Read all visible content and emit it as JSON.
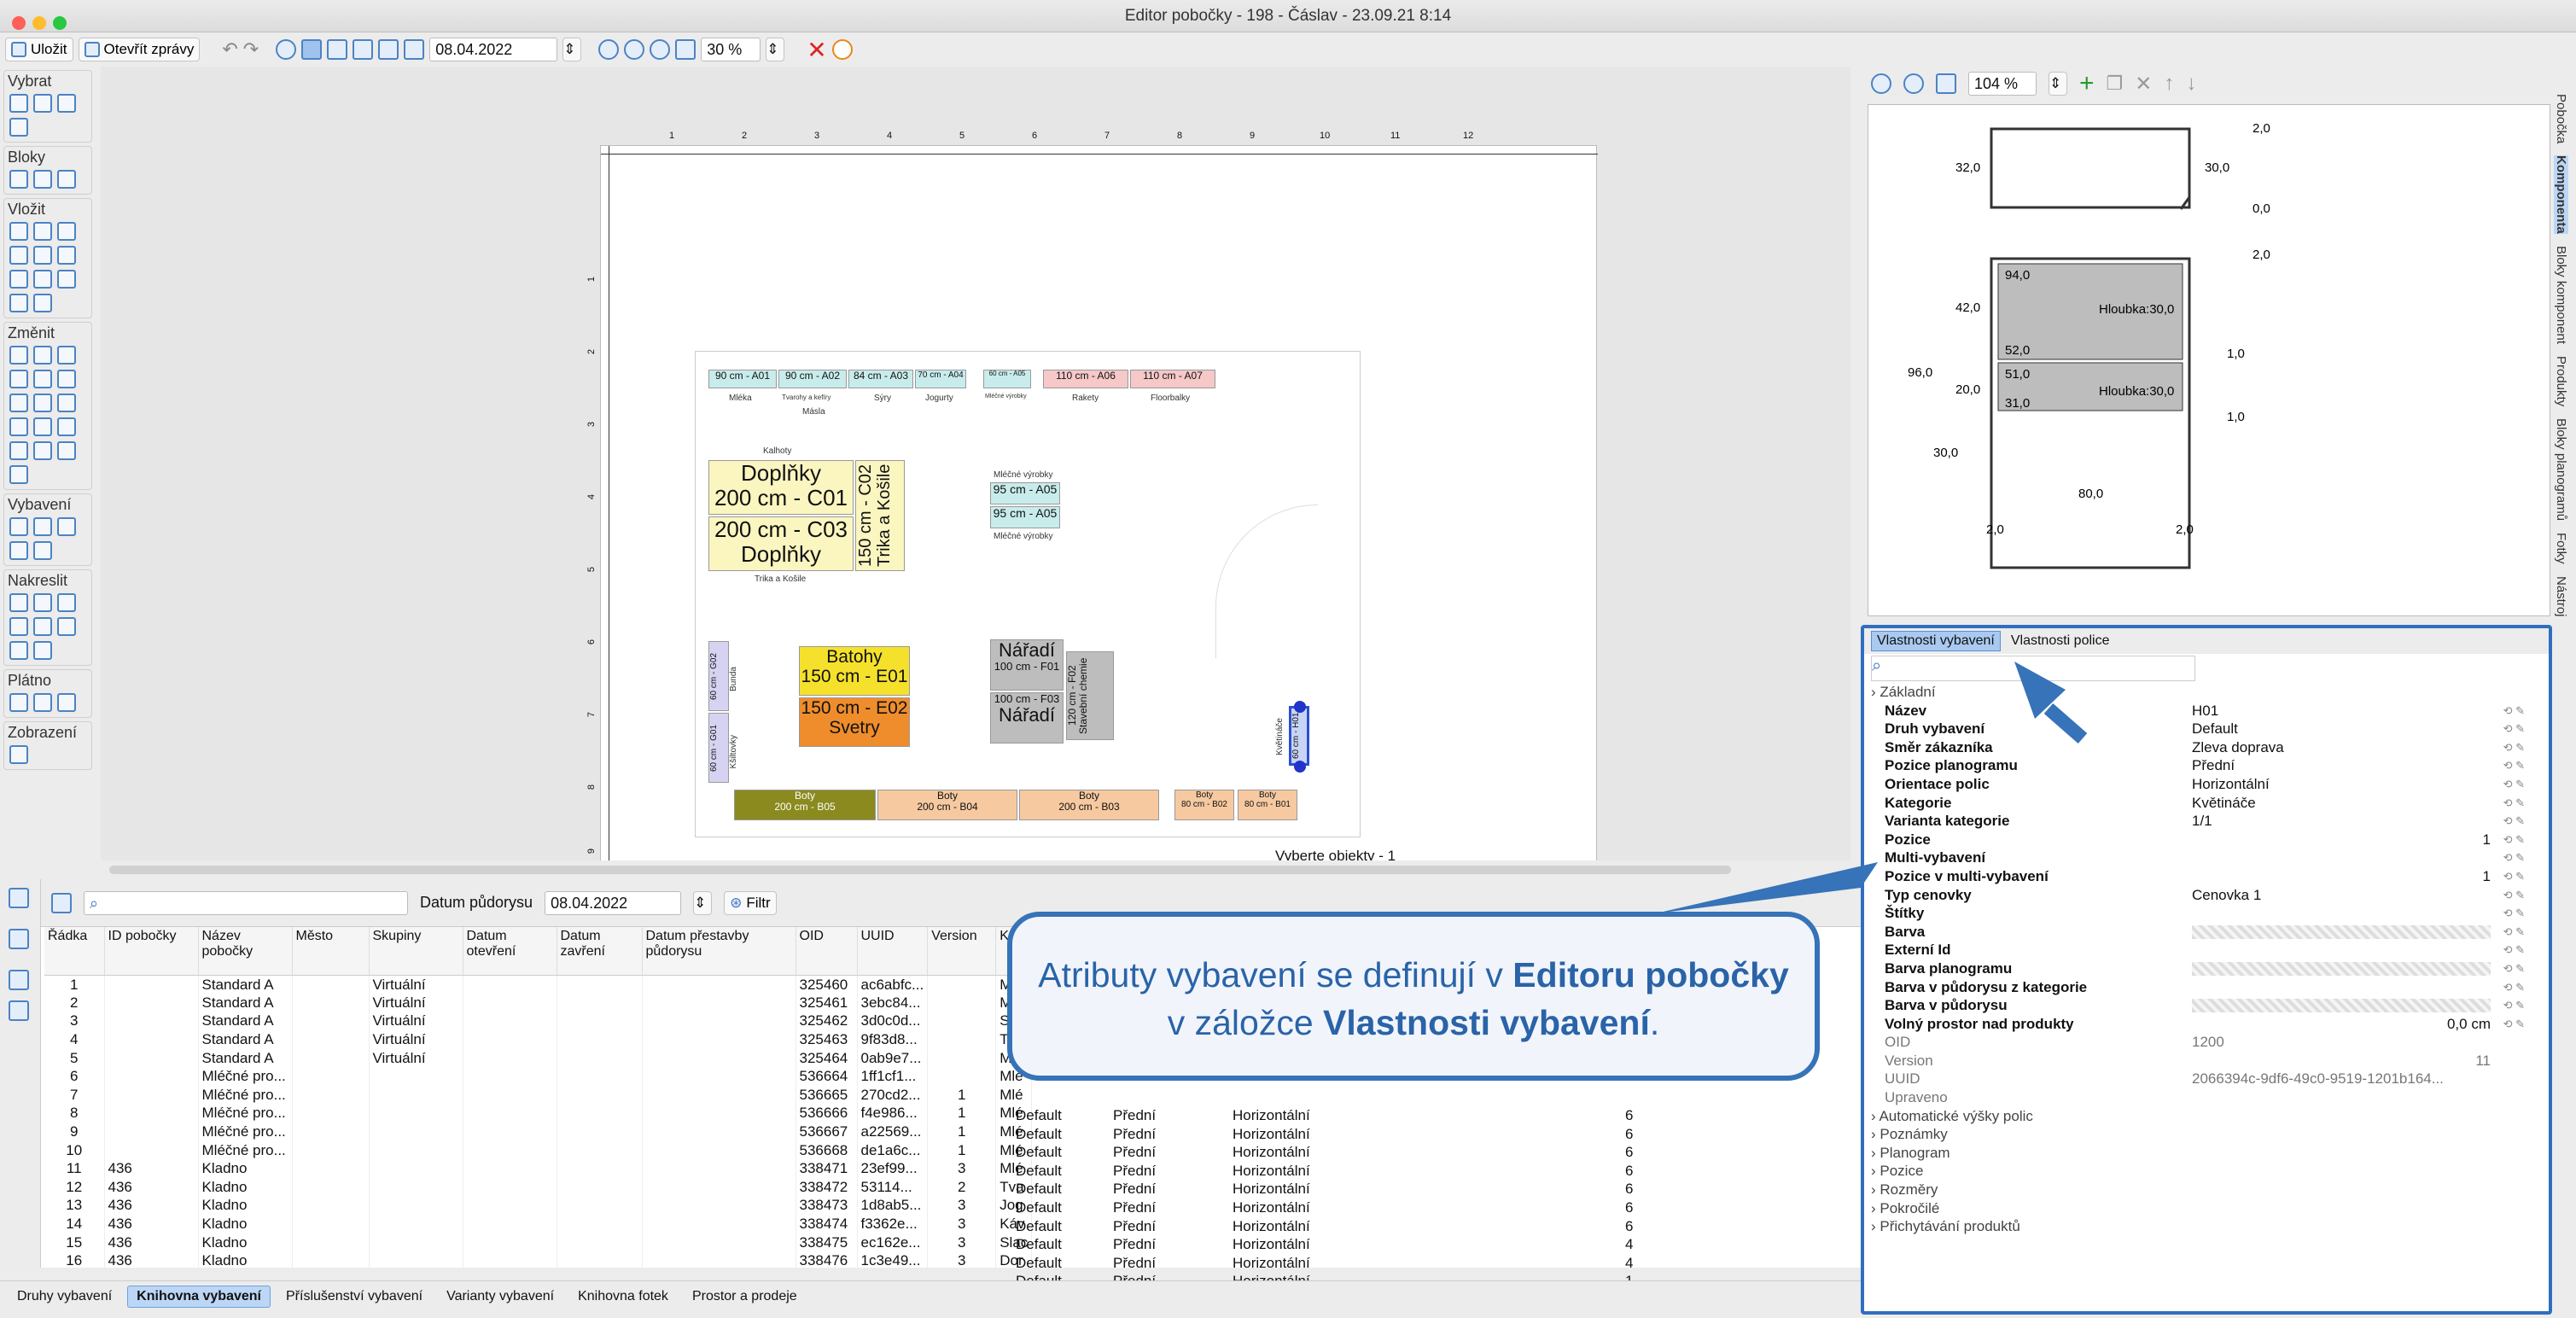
{
  "window": {
    "title": "Editor pobočky - 198 - Čáslav - 23.09.21 8:14"
  },
  "toolbar": {
    "save": "Uložit",
    "open_reports": "Otevřít zprávy",
    "date": "08.04.2022",
    "zoom": "30 %"
  },
  "palette": {
    "groups": [
      "Vybrat",
      "Bloky",
      "Vložit",
      "Změnit",
      "Vybavení",
      "Nakreslit",
      "Plátno",
      "Zobrazení"
    ]
  },
  "canvas": {
    "ruler_top": [
      "1",
      "2",
      "3",
      "4",
      "5",
      "6",
      "7",
      "8",
      "9",
      "10",
      "11",
      "12"
    ],
    "ruler_left": [
      "1",
      "2",
      "3",
      "4",
      "5",
      "6",
      "7",
      "8",
      "9",
      "10"
    ],
    "status": "Vyberte objekty - 1",
    "blocks": [
      {
        "t": "90 cm - A01",
        "s": "Mléka"
      },
      {
        "t": "90 cm - A02",
        "s": "Tvarohy a kefíry"
      },
      {
        "t": "84 cm - A03",
        "s": "Sýry"
      },
      {
        "t": "70 cm - A04",
        "s": "Jogurty"
      },
      {
        "t": "60 cm - A05",
        "s": "Mléčné výrobky"
      },
      {
        "t": "110 cm - A06",
        "s": "Rakety"
      },
      {
        "t": "110 cm - A07",
        "s": "Floorbalky"
      }
    ],
    "masla": "Másla",
    "kalhoty": "Kalhoty",
    "doplnky": "Doplňky",
    "c01": "200 cm - C01",
    "c03": "200 cm - C03",
    "doplnky2": "Doplňky",
    "trika_kosile": "Trika a Košile",
    "c02": "150 cm - C02",
    "trika2": "Trika a Košile",
    "mlecne": "Mléčné výrobky",
    "a05a": "95 cm - A05",
    "a05b": "95 cm - A05",
    "mlecne2": "Mléčné výrobky",
    "batohy": "Batohy",
    "e01": "150 cm - E01",
    "e02": "150 cm - E02",
    "svetry": "Svetry",
    "naradi": "Nářadí",
    "f01": "100 cm - F01",
    "f03": "100 cm - F03",
    "naradi2": "Nářadí",
    "f02": "120 cm - F02",
    "chemie": "Stavební chemie",
    "g02": "60 cm - G02",
    "g01": "60 cm - G01",
    "bunda": "Bunda",
    "susak": "Kšiltovky",
    "h01": "60 cm - H01",
    "kvetinace": "Květináče",
    "boty": [
      {
        "t": "200 cm - B05",
        "s": "Boty"
      },
      {
        "t": "200 cm - B04",
        "s": "Boty"
      },
      {
        "t": "200 cm - B03",
        "s": "Boty"
      },
      {
        "t": "80 cm - B02",
        "s": "Boty"
      },
      {
        "t": "80 cm - B01",
        "s": "Boty"
      }
    ]
  },
  "bottom": {
    "date_label": "Datum půdorysu",
    "date": "08.04.2022",
    "filter": "Filtr",
    "columns": [
      "Řádka",
      "ID pobočky",
      "Název pobočky",
      "Město",
      "Skupiny",
      "Datum otevření",
      "Datum zavření",
      "Datum přestavby půdorysu",
      "OID",
      "UUID",
      "Version",
      "Kat"
    ],
    "rows": [
      [
        "1",
        "",
        "Standard A",
        "",
        "Virtuální",
        "",
        "",
        "",
        "325460",
        "ac6abfc...",
        "",
        "Mlé"
      ],
      [
        "2",
        "",
        "Standard A",
        "",
        "Virtuální",
        "",
        "",
        "",
        "325461",
        "3ebc84...",
        "",
        "Mlé"
      ],
      [
        "3",
        "",
        "Standard A",
        "",
        "Virtuální",
        "",
        "",
        "",
        "325462",
        "3d0c0d...",
        "",
        "Slac"
      ],
      [
        "4",
        "",
        "Standard A",
        "",
        "Virtuální",
        "",
        "",
        "",
        "325463",
        "9f83d8...",
        "",
        "Tva"
      ],
      [
        "5",
        "",
        "Standard A",
        "",
        "Virtuální",
        "",
        "",
        "",
        "325464",
        "0ab9e7...",
        "",
        "Mlé"
      ],
      [
        "6",
        "",
        "Mléčné pro...",
        "",
        "",
        "",
        "",
        "",
        "536664",
        "1ff1cf1...",
        "",
        "Mlé"
      ],
      [
        "7",
        "",
        "Mléčné pro...",
        "",
        "",
        "",
        "",
        "",
        "536665",
        "270cd2...",
        "1",
        "Mlé"
      ],
      [
        "8",
        "",
        "Mléčné pro...",
        "",
        "",
        "",
        "",
        "",
        "536666",
        "f4e986...",
        "1",
        "Mlé"
      ],
      [
        "9",
        "",
        "Mléčné pro...",
        "",
        "",
        "",
        "",
        "",
        "536667",
        "a22569...",
        "1",
        "Mlé"
      ],
      [
        "10",
        "",
        "Mléčné pro...",
        "",
        "",
        "",
        "",
        "",
        "536668",
        "de1a6c...",
        "1",
        "Mlé"
      ],
      [
        "11",
        "436",
        "Kladno",
        "",
        "",
        "",
        "",
        "",
        "338471",
        "23ef99...",
        "3",
        "Mlé"
      ],
      [
        "12",
        "436",
        "Kladno",
        "",
        "",
        "",
        "",
        "",
        "338472",
        "53114...",
        "2",
        "Tva"
      ],
      [
        "13",
        "436",
        "Kladno",
        "",
        "",
        "",
        "",
        "",
        "338473",
        "1d8ab5...",
        "3",
        "Jog"
      ],
      [
        "14",
        "436",
        "Kladno",
        "",
        "",
        "",
        "",
        "",
        "338474",
        "f3362e...",
        "3",
        "Káv"
      ],
      [
        "15",
        "436",
        "Kladno",
        "",
        "",
        "",
        "",
        "",
        "338475",
        "ec162e...",
        "3",
        "Slac"
      ],
      [
        "16",
        "436",
        "Kladno",
        "",
        "",
        "",
        "",
        "",
        "338476",
        "1c3e49...",
        "3",
        "Dor"
      ]
    ],
    "extra_cols": [
      [
        "Default",
        "Přední",
        "Horizontální",
        "6"
      ],
      [
        "Default",
        "Přední",
        "Horizontální",
        "6"
      ],
      [
        "Default",
        "Přední",
        "Horizontální",
        "6"
      ],
      [
        "Default",
        "Přední",
        "Horizontální",
        "6"
      ],
      [
        "Default",
        "Přední",
        "Horizontální",
        "6"
      ],
      [
        "Default",
        "Přední",
        "Horizontální",
        "6"
      ],
      [
        "Default",
        "Přední",
        "Horizontální",
        "6"
      ],
      [
        "Default",
        "Přední",
        "Horizontální",
        "4"
      ],
      [
        "Default",
        "Přední",
        "Horizontální",
        "4"
      ],
      [
        "Default",
        "Přední",
        "Horizontální",
        "1"
      ],
      [
        "Default",
        "Přední",
        "Horizontální",
        "2"
      ]
    ]
  },
  "tabs": [
    "Druhy vybavení",
    "Knihovna vybavení",
    "Příslušenství vybavení",
    "Varianty vybavení",
    "Knihovna fotek",
    "Prostor a prodeje"
  ],
  "right": {
    "zoom": "104 %",
    "dims": {
      "d1": "2,0",
      "d2": "32,0",
      "d3": "30,0",
      "d4": "0,0",
      "d5": "2,0",
      "d6": "94,0",
      "d7": "42,0",
      "d8": "Hloubka:30,0",
      "d9": "52,0",
      "d10": "1,0",
      "d11": "96,0",
      "d12": "20,0",
      "d13": "51,0",
      "d14": "Hloubka:30,0",
      "d15": "31,0",
      "d16": "1,0",
      "d17": "30,0",
      "d18": "80,0",
      "d19": "2,0",
      "d20": "2,0"
    },
    "tab_props": "Vlastnosti vybavení",
    "tab_shelf": "Vlastnosti police",
    "section": "Základní",
    "props": [
      [
        "Název",
        "H01"
      ],
      [
        "Druh vybavení",
        "Default"
      ],
      [
        "Směr zákazníka",
        "Zleva doprava"
      ],
      [
        "Pozice planogramu",
        "Přední"
      ],
      [
        "Orientace polic",
        "Horizontální"
      ],
      [
        "Kategorie",
        "Květináče"
      ],
      [
        "Varianta kategorie",
        "1/1"
      ],
      [
        "Pozice",
        "1"
      ],
      [
        "Multi-vybavení",
        ""
      ],
      [
        "Pozice v multi-vybavení",
        "1"
      ],
      [
        "Typ cenovky",
        "Cenovka 1"
      ],
      [
        "Štítky",
        ""
      ],
      [
        "Barva",
        ""
      ],
      [
        "Externí Id",
        ""
      ],
      [
        "Barva planogramu",
        ""
      ],
      [
        "Barva v půdorysu z kategorie",
        ""
      ],
      [
        "Barva v půdorysu",
        ""
      ],
      [
        "Volný prostor nad produkty",
        "0,0 cm"
      ]
    ],
    "props_grey": [
      [
        "OID",
        "1200"
      ],
      [
        "Version",
        "11"
      ],
      [
        "UUID",
        "2066394c-9df6-49c0-9519-1201b164..."
      ],
      [
        "Upraveno",
        ""
      ]
    ],
    "sections": [
      "Automatické výšky polic",
      "Poznámky",
      "Planogram",
      "Pozice",
      "Rozměry",
      "Pokročilé",
      "Přichytávání produktů"
    ]
  },
  "vtabs": [
    "Pobočka",
    "Komponenta",
    "Bloky komponent",
    "Produkty",
    "Bloky planogramů",
    "Fotky",
    "Nástroj"
  ],
  "callout": {
    "a": "Atributy vybavení se definují v ",
    "b": "Editoru pobočky",
    "c": " v záložce ",
    "d": "Vlastnosti vybavení",
    "e": "."
  }
}
